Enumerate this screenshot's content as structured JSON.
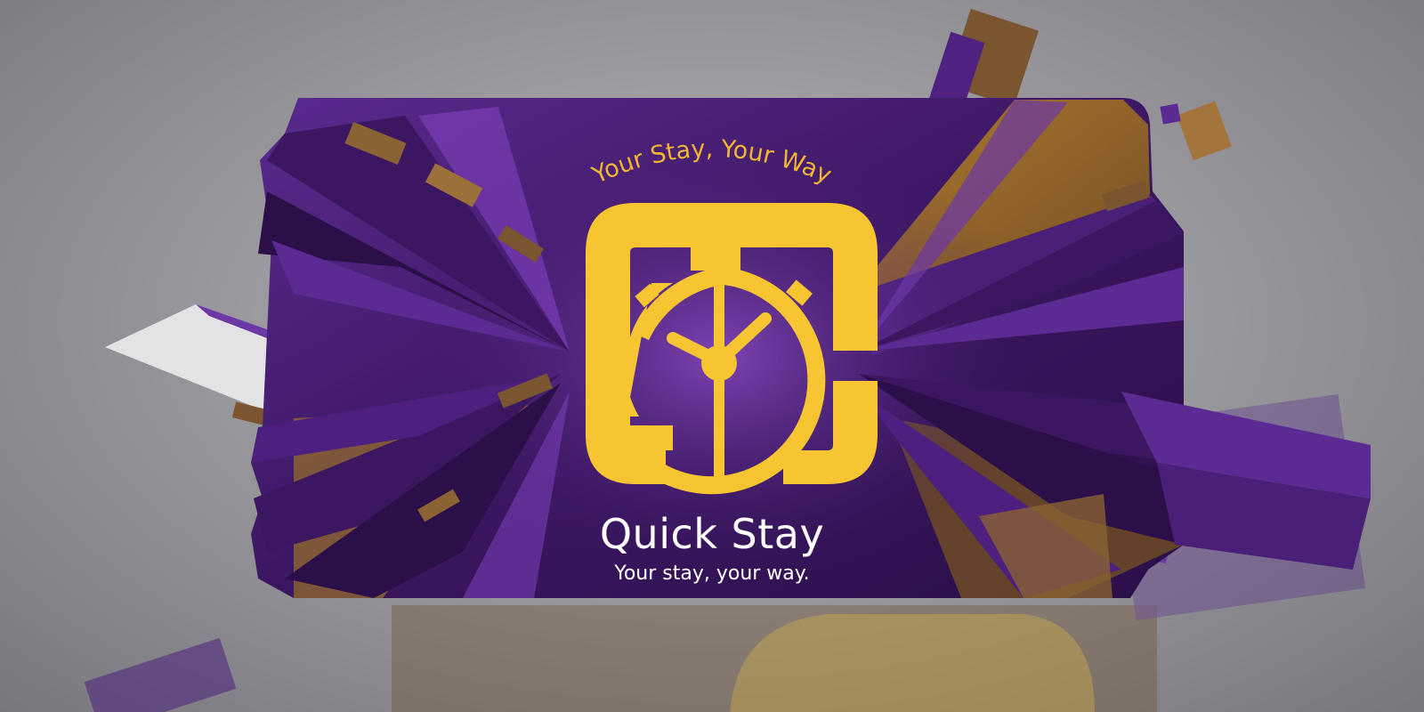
{
  "banner": {
    "tagline_top": "Your Stay, Your Way",
    "brand_name": "Quick Stay",
    "slogan": "Your stay, your way."
  },
  "colors": {
    "purple_deep": "#3a1760",
    "purple": "#5b2a93",
    "purple_light": "#8a4bc4",
    "gold": "#f7c531",
    "gold_text": "#f2b531",
    "bronze": "#8a6233",
    "background": "#9a9a9f"
  },
  "icons": {
    "logo": "clock-in-rounded-square-icon"
  }
}
